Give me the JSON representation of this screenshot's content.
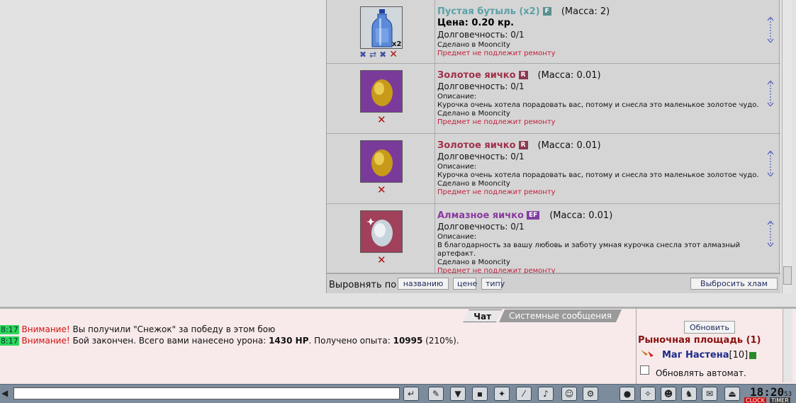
{
  "items": [
    {
      "name": "Пустая бутыль (x2)",
      "badge": "F",
      "mass": "(Масса: 2)",
      "price": "Цена: 0.20 кр.",
      "durability": "Долговечность: 0/1",
      "made_in": "Сделано в Mooncity",
      "no_repair": "Предмет не подлежит ремонту",
      "count": "x2",
      "icon": "bottle-icon"
    },
    {
      "name": "Золотое яичко",
      "badge": "R",
      "mass": "(Масса: 0.01)",
      "durability": "Долговечность: 0/1",
      "desc_label": "Описание:",
      "description": "Курочка очень хотела порадовать вас, потому и снесла это маленькое золотое чудо.",
      "made_in": "Сделано в Mooncity",
      "no_repair": "Предмет не подлежит ремонту",
      "icon": "golden-egg-icon"
    },
    {
      "name": "Золотое яичко",
      "badge": "R",
      "mass": "(Масса: 0.01)",
      "durability": "Долговечность: 0/1",
      "desc_label": "Описание:",
      "description": "Курочка очень хотела порадовать вас, потому и снесла это маленькое золотое чудо.",
      "made_in": "Сделано в Mooncity",
      "no_repair": "Предмет не подлежит ремонту",
      "icon": "golden-egg-icon"
    },
    {
      "name": "Алмазное яичко",
      "badge": "EF",
      "mass": "(Масса: 0.01)",
      "durability": "Долговечность: 0/1",
      "desc_label": "Описание:",
      "description": "В благодарность за вашу любовь и заботу умная курочка снесла этот алмазный артефакт.",
      "made_in": "Сделано в Mooncity",
      "no_repair": "Предмет не подлежит ремонту",
      "icon": "diamond-egg-icon"
    }
  ],
  "sort": {
    "label": "Выровнять по",
    "by_name": "названию",
    "by_price": "цене",
    "by_type": "типу",
    "discard": "Выбросить хлам"
  },
  "chat": {
    "tabs": [
      "Чат",
      "Системные сообщения"
    ],
    "active_tab": "Чат",
    "messages": [
      {
        "time": "8:17",
        "warn": "Внимание!",
        "text": " Вы получили \"Снежок\" за победу в этом бою"
      },
      {
        "time": "8:17",
        "warn": "Внимание!",
        "text1": " Бой закончен. Всего вами нанесено урона: ",
        "damage": "1430 HP",
        "text2": ". Получено опыта: ",
        "exp": "10995",
        "text3": " (210%)."
      }
    ]
  },
  "online": {
    "refresh": "Обновить",
    "location": "Рыночная площадь (1)",
    "player_name": "Маг Настена",
    "player_level": "[10]",
    "auto_refresh": "Обновлять автомат."
  },
  "clock": {
    "time": "18:20",
    "seconds": "53",
    "clock_label": "CLOCK",
    "timer_label": "TIMER"
  },
  "colors": {
    "item_name_bottle": "#5aa1a8",
    "item_name_gold": "#a0304a",
    "item_name_diamond": "#8a3aa0",
    "badge_f": "#5a9090",
    "badge_r": "#8a3a50",
    "badge_ef": "#8040a0",
    "warn": "#d01010"
  }
}
